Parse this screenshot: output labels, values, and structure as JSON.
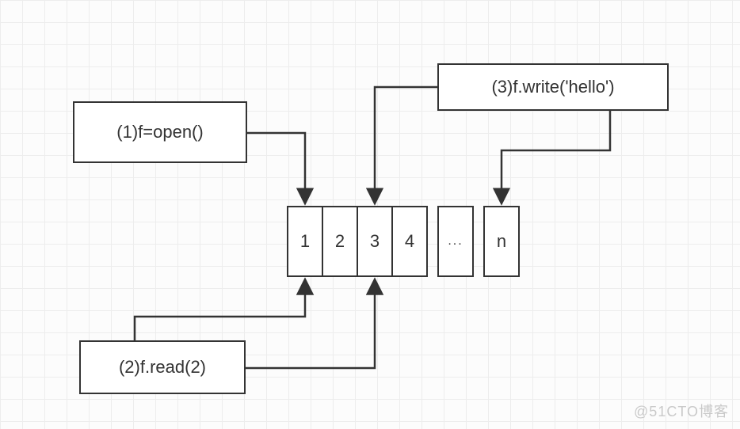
{
  "boxes": {
    "open": {
      "label": "(1)f=open()"
    },
    "read": {
      "label": "(2)f.read(2)"
    },
    "write": {
      "label": "(3)f.write('hello')"
    }
  },
  "cells": [
    "1",
    "2",
    "3",
    "4",
    "...",
    "n"
  ],
  "watermark": "@51CTO博客"
}
